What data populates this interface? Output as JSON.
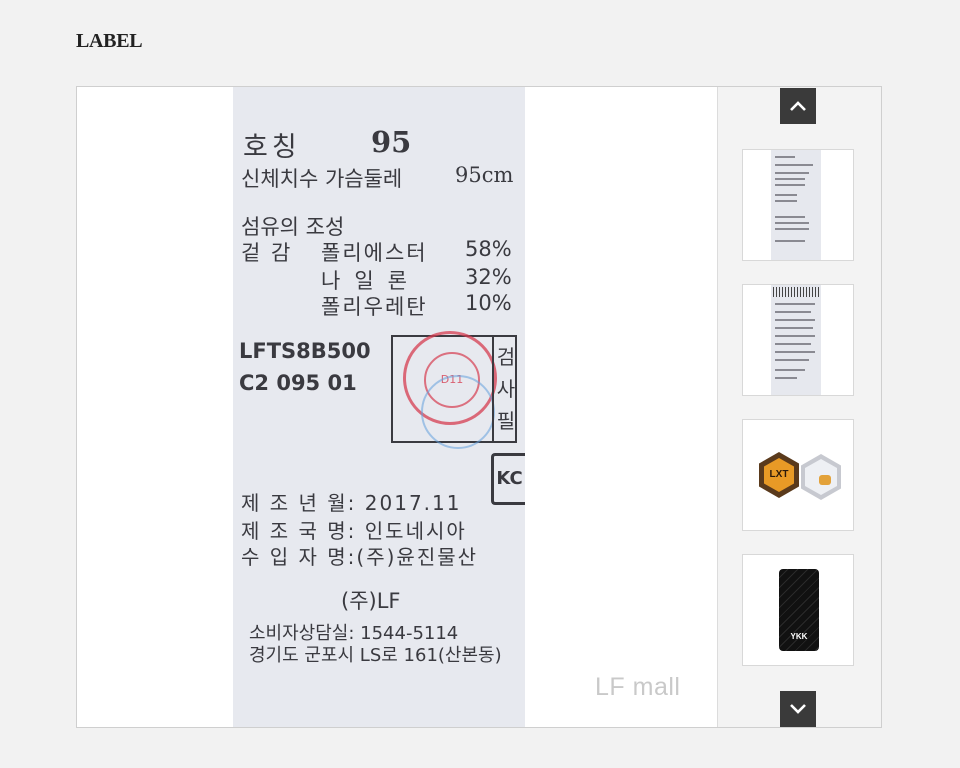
{
  "section": {
    "title": "LABEL"
  },
  "label": {
    "size_key": "호칭",
    "size_value": "95",
    "body_key": "신체치수 가슴둘레",
    "body_value": "95cm",
    "fiber_title": "섬유의 조성",
    "outer_key": "겉 감",
    "fibers": [
      {
        "name": "폴리에스터",
        "percent": "58%"
      },
      {
        "name": "나일론",
        "percent": "32%"
      },
      {
        "name": "폴리우레탄",
        "percent": "10%"
      }
    ],
    "code1": "LFTS8B500",
    "code2": "C2 095 01",
    "inspection": "검사필",
    "stamp_text": "D11",
    "kc_mark": "KC",
    "mfg_date": "제 조 년 월: 2017.11",
    "mfg_country": "제 조 국 명: 인도네시아",
    "importer": "수 입 자 명:(주)윤진물산",
    "brand": "(주)LF",
    "cs_phone": "소비자상담실: 1544-5114",
    "address": "경기도 군포시 LS로 161(산본동)"
  },
  "watermark": "LF mall",
  "thumbs": {
    "tag_text": "LXT",
    "zipper_text": "YKK"
  },
  "colors": {
    "page_bg": "#f2f2f2",
    "nav_button": "#3a3a3a",
    "label_fabric": "#e7e9ef"
  },
  "icons": {
    "up": "chevron-up-icon",
    "down": "chevron-down-icon"
  }
}
